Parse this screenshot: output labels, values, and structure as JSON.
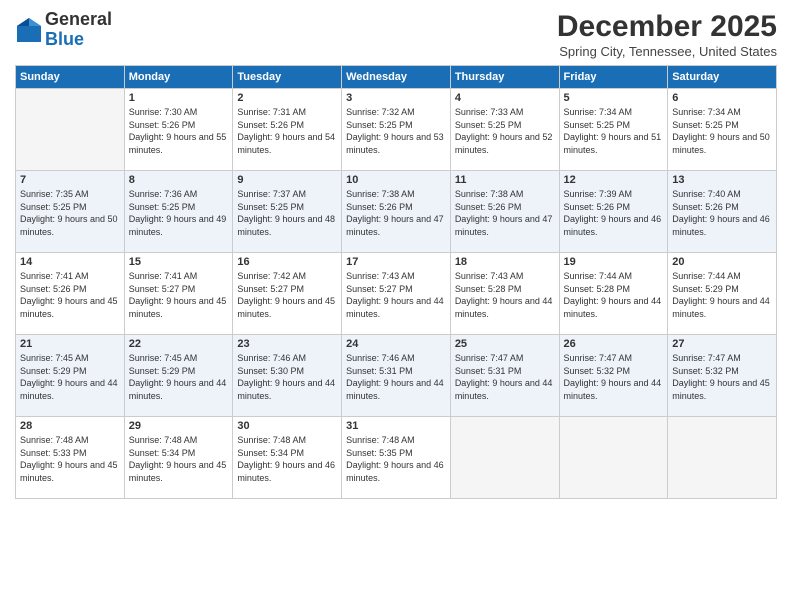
{
  "header": {
    "logo_line1": "General",
    "logo_line2": "Blue",
    "month_title": "December 2025",
    "location": "Spring City, Tennessee, United States"
  },
  "days_of_week": [
    "Sunday",
    "Monday",
    "Tuesday",
    "Wednesday",
    "Thursday",
    "Friday",
    "Saturday"
  ],
  "weeks": [
    [
      {
        "day": "",
        "info": ""
      },
      {
        "day": "1",
        "info": "Sunrise: 7:30 AM\nSunset: 5:26 PM\nDaylight: 9 hours\nand 55 minutes."
      },
      {
        "day": "2",
        "info": "Sunrise: 7:31 AM\nSunset: 5:26 PM\nDaylight: 9 hours\nand 54 minutes."
      },
      {
        "day": "3",
        "info": "Sunrise: 7:32 AM\nSunset: 5:25 PM\nDaylight: 9 hours\nand 53 minutes."
      },
      {
        "day": "4",
        "info": "Sunrise: 7:33 AM\nSunset: 5:25 PM\nDaylight: 9 hours\nand 52 minutes."
      },
      {
        "day": "5",
        "info": "Sunrise: 7:34 AM\nSunset: 5:25 PM\nDaylight: 9 hours\nand 51 minutes."
      },
      {
        "day": "6",
        "info": "Sunrise: 7:34 AM\nSunset: 5:25 PM\nDaylight: 9 hours\nand 50 minutes."
      }
    ],
    [
      {
        "day": "7",
        "info": "Sunrise: 7:35 AM\nSunset: 5:25 PM\nDaylight: 9 hours\nand 50 minutes."
      },
      {
        "day": "8",
        "info": "Sunrise: 7:36 AM\nSunset: 5:25 PM\nDaylight: 9 hours\nand 49 minutes."
      },
      {
        "day": "9",
        "info": "Sunrise: 7:37 AM\nSunset: 5:25 PM\nDaylight: 9 hours\nand 48 minutes."
      },
      {
        "day": "10",
        "info": "Sunrise: 7:38 AM\nSunset: 5:26 PM\nDaylight: 9 hours\nand 47 minutes."
      },
      {
        "day": "11",
        "info": "Sunrise: 7:38 AM\nSunset: 5:26 PM\nDaylight: 9 hours\nand 47 minutes."
      },
      {
        "day": "12",
        "info": "Sunrise: 7:39 AM\nSunset: 5:26 PM\nDaylight: 9 hours\nand 46 minutes."
      },
      {
        "day": "13",
        "info": "Sunrise: 7:40 AM\nSunset: 5:26 PM\nDaylight: 9 hours\nand 46 minutes."
      }
    ],
    [
      {
        "day": "14",
        "info": "Sunrise: 7:41 AM\nSunset: 5:26 PM\nDaylight: 9 hours\nand 45 minutes."
      },
      {
        "day": "15",
        "info": "Sunrise: 7:41 AM\nSunset: 5:27 PM\nDaylight: 9 hours\nand 45 minutes."
      },
      {
        "day": "16",
        "info": "Sunrise: 7:42 AM\nSunset: 5:27 PM\nDaylight: 9 hours\nand 45 minutes."
      },
      {
        "day": "17",
        "info": "Sunrise: 7:43 AM\nSunset: 5:27 PM\nDaylight: 9 hours\nand 44 minutes."
      },
      {
        "day": "18",
        "info": "Sunrise: 7:43 AM\nSunset: 5:28 PM\nDaylight: 9 hours\nand 44 minutes."
      },
      {
        "day": "19",
        "info": "Sunrise: 7:44 AM\nSunset: 5:28 PM\nDaylight: 9 hours\nand 44 minutes."
      },
      {
        "day": "20",
        "info": "Sunrise: 7:44 AM\nSunset: 5:29 PM\nDaylight: 9 hours\nand 44 minutes."
      }
    ],
    [
      {
        "day": "21",
        "info": "Sunrise: 7:45 AM\nSunset: 5:29 PM\nDaylight: 9 hours\nand 44 minutes."
      },
      {
        "day": "22",
        "info": "Sunrise: 7:45 AM\nSunset: 5:29 PM\nDaylight: 9 hours\nand 44 minutes."
      },
      {
        "day": "23",
        "info": "Sunrise: 7:46 AM\nSunset: 5:30 PM\nDaylight: 9 hours\nand 44 minutes."
      },
      {
        "day": "24",
        "info": "Sunrise: 7:46 AM\nSunset: 5:31 PM\nDaylight: 9 hours\nand 44 minutes."
      },
      {
        "day": "25",
        "info": "Sunrise: 7:47 AM\nSunset: 5:31 PM\nDaylight: 9 hours\nand 44 minutes."
      },
      {
        "day": "26",
        "info": "Sunrise: 7:47 AM\nSunset: 5:32 PM\nDaylight: 9 hours\nand 44 minutes."
      },
      {
        "day": "27",
        "info": "Sunrise: 7:47 AM\nSunset: 5:32 PM\nDaylight: 9 hours\nand 45 minutes."
      }
    ],
    [
      {
        "day": "28",
        "info": "Sunrise: 7:48 AM\nSunset: 5:33 PM\nDaylight: 9 hours\nand 45 minutes."
      },
      {
        "day": "29",
        "info": "Sunrise: 7:48 AM\nSunset: 5:34 PM\nDaylight: 9 hours\nand 45 minutes."
      },
      {
        "day": "30",
        "info": "Sunrise: 7:48 AM\nSunset: 5:34 PM\nDaylight: 9 hours\nand 46 minutes."
      },
      {
        "day": "31",
        "info": "Sunrise: 7:48 AM\nSunset: 5:35 PM\nDaylight: 9 hours\nand 46 minutes."
      },
      {
        "day": "",
        "info": ""
      },
      {
        "day": "",
        "info": ""
      },
      {
        "day": "",
        "info": ""
      }
    ]
  ]
}
